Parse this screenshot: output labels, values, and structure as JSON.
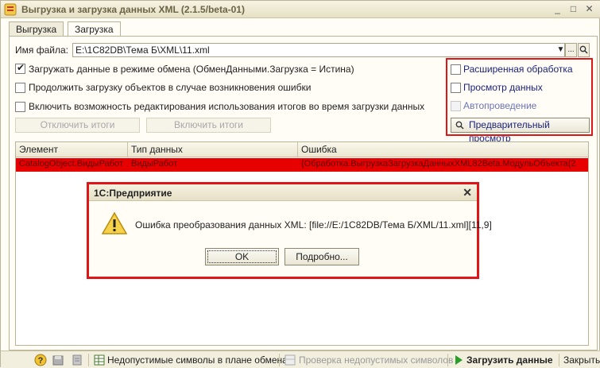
{
  "window": {
    "title": "Выгрузка и загрузка данных XML (2.1.5/beta-01)",
    "minimize": "_",
    "maximize": "□",
    "close": "✕"
  },
  "tabs": [
    {
      "label": "Выгрузка",
      "active": false
    },
    {
      "label": "Загрузка",
      "active": true
    }
  ],
  "file": {
    "label": "Имя файла:",
    "value": "E:\\1C82DB\\Тема Б\\XML\\11.xml",
    "dropdown": "▼",
    "browse": "..."
  },
  "options": {
    "exchange_mode": {
      "label": "Загружать данные в режиме обмена (ОбменДанными.Загрузка = Истина)",
      "checked": true
    },
    "continue_on_error": {
      "label": "Продолжить загрузку объектов в случае возникновения ошибки",
      "checked": false
    },
    "totals_editing": {
      "label": "Включить возможность редактирования использования итогов во время загрузки данных",
      "checked": false
    }
  },
  "buttons": {
    "disable_totals": "Отключить итоги",
    "enable_totals": "Включить итоги"
  },
  "right_panel": {
    "extended_processing": "Расширенная обработка",
    "view_data": "Просмотр данных",
    "auto_posting": "Автопроведение",
    "preview": "Предварительный просмотр"
  },
  "table": {
    "columns": [
      "Элемент",
      "Тип данных",
      "Ошибка"
    ],
    "rows": [
      [
        "CatalogObject.ВидыРабот",
        "ВидыРабот",
        "{Обработка.ВыгрузкаЗагрузкаДанныхXML82Beta.МодульОбъекта(2"
      ]
    ]
  },
  "dialog": {
    "title": "1С:Предприятие",
    "message": "Ошибка преобразования данных XML: [file://E:/1C82DB/Тема Б/XML/11.xml][11,9]",
    "ok": "OK",
    "details": "Подробно...",
    "close": "✕"
  },
  "statusbar": {
    "help": "?",
    "invalid_chars": "Недопустимые символы в плане обмена",
    "check_invalid": "Проверка недопустимых символов",
    "load_data": "Загрузить данные",
    "close": "Закрыть"
  },
  "colors": {
    "highlight_red": "#e01515",
    "error_row": "#e60000",
    "load_green": "#2a9d2a"
  }
}
